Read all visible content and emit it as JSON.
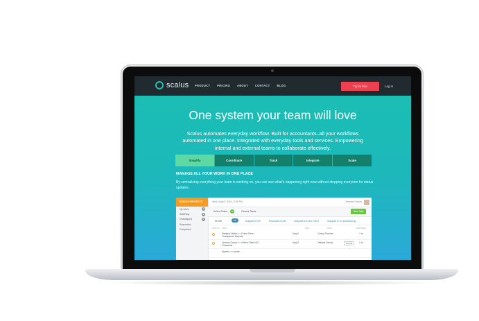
{
  "nav": {
    "logo": "scalus",
    "links": [
      "PRODUCT",
      "PRICING",
      "ABOUT",
      "CONTACT",
      "BLOG"
    ],
    "cta": "Try for free",
    "login": "Log In"
  },
  "hero": {
    "title": "One system your team will love",
    "subtitle": "Scalus automates everyday workflow. Built for accountants–all your workflows automated in one place. Integrated with everyday tools and services. Empowering internal and external teams to collaborate effectively."
  },
  "tabs": [
    {
      "label": "Simplify",
      "active": true
    },
    {
      "label": "Coordinate",
      "active": false
    },
    {
      "label": "Track",
      "active": false
    },
    {
      "label": "Integrate",
      "active": false
    },
    {
      "label": "Scale",
      "active": false
    }
  ],
  "section": {
    "title": "MANAGE ALL YOUR WORK IN ONE PLACE",
    "body": "By centralizing everything your team is working on, you can see what’s happening right now without stopping everyone for status updates."
  },
  "app": {
    "sidebar_title": "TASKS & PROJECTS",
    "sidebar_items": [
      {
        "label": "My Work",
        "count": "3"
      },
      {
        "label": "Watching",
        "count": "2"
      },
      {
        "label": "Unassigned",
        "count": "4"
      },
      {
        "label": "Requested",
        "count": ""
      },
      {
        "label": "Completed",
        "count": ""
      }
    ],
    "date": "Wed, Aug 5, 2015, 3:35 PM",
    "user": "Jessica Garcia",
    "active_tasks": "Active Tasks",
    "active_count": "4",
    "closed_tasks": "Closed Tasks",
    "new_task": "New Task",
    "filters": {
      "show": "SHOW",
      "all": "All",
      "items": [
        "Assigned to Me",
        "Requested by Me",
        "Assigned to A New Client",
        "Assigned to Try Bookkeeping"
      ]
    },
    "columns": [
      "STATUS",
      "TASK",
      "DUE",
      "WHO",
      "SECONDS"
    ],
    "rows": [
      {
        "task": "Marjorie Walsh >> Prime Pace Transparent Reports",
        "due": "Aug 5",
        "who": "Casey Thomas",
        "tag": "",
        "time": "1 hr"
      },
      {
        "task": "Jessica Garcia >> A New Client Q3 Financials",
        "due": "Aug 5",
        "who": "Jessica Garcia",
        "tag": "Payroll",
        "time": "2 hr"
      },
      {
        "task": "System >> andre",
        "due": "",
        "who": "",
        "tag": "",
        "time": ""
      }
    ]
  }
}
